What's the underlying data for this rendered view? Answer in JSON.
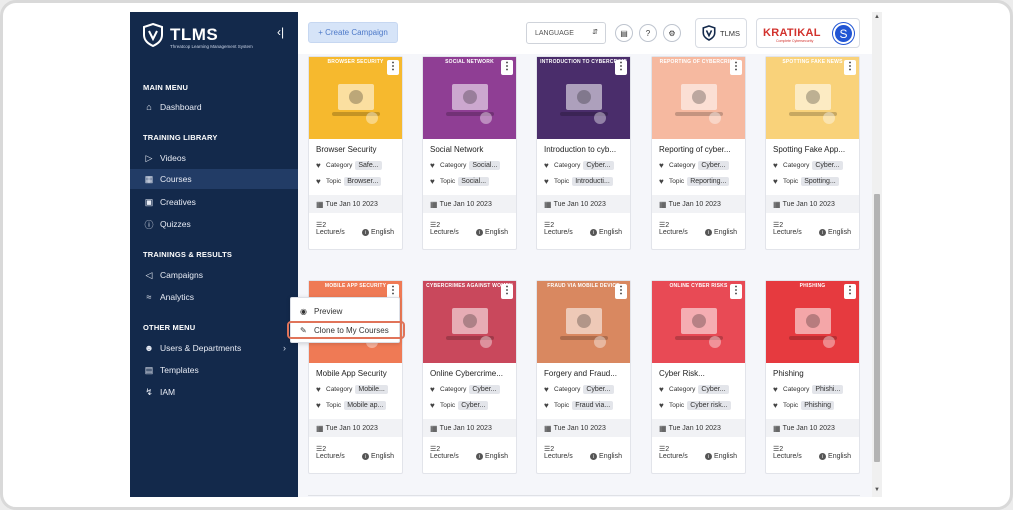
{
  "brand": {
    "name": "TLMS",
    "tagline": "Threatcop Learning Management System"
  },
  "sidebar": {
    "sections": [
      {
        "title": "MAIN MENU"
      },
      {
        "title": "TRAINING LIBRARY"
      },
      {
        "title": "TRAININGS & RESULTS"
      },
      {
        "title": "OTHER MENU"
      }
    ],
    "items": [
      {
        "label": "Dashboard",
        "icon": "home-icon"
      },
      {
        "label": "Videos",
        "icon": "video-icon"
      },
      {
        "label": "Courses",
        "icon": "book-icon",
        "active": true
      },
      {
        "label": "Creatives",
        "icon": "image-icon"
      },
      {
        "label": "Quizzes",
        "icon": "question-icon"
      },
      {
        "label": "Campaigns",
        "icon": "megaphone-icon"
      },
      {
        "label": "Analytics",
        "icon": "chart-icon"
      },
      {
        "label": "Users & Departments",
        "icon": "user-icon"
      },
      {
        "label": "Templates",
        "icon": "template-icon"
      },
      {
        "label": "IAM",
        "icon": "key-icon"
      }
    ]
  },
  "topbar": {
    "create_label": "+ Create Campaign",
    "language_label": "LANGUAGE",
    "tlms_label": "TLMS",
    "org_name": "KRATIKAL",
    "org_sub": "Complete Cybersecurity",
    "avatar_letter": "S"
  },
  "colors": {
    "sidebar_bg": "#13294b",
    "accent": "#4d79c8",
    "highlight": "#e0745a"
  },
  "courses": [
    {
      "thumb_title": "BROWSER SECURITY",
      "bg": "#f6b92e",
      "title": "Browser Security",
      "category": "Safe...",
      "topic": "Browser...",
      "date": "Tue Jan 10 2023",
      "lectures_num": "2",
      "lectures_unit": "Lecture/s",
      "lang": "English"
    },
    {
      "thumb_title": "SOCIAL NETWORK",
      "bg": "#8f3e94",
      "title": "Social Network",
      "category": "Social...",
      "topic": "Social...",
      "date": "Tue Jan 10 2023",
      "lectures_num": "2",
      "lectures_unit": "Lecture/s",
      "lang": "English"
    },
    {
      "thumb_title": "INTRODUCTION TO CYBERCRIME",
      "bg": "#4a2d6b",
      "title": "Introduction to cyb...",
      "category": "Cyber...",
      "topic": "Introducti...",
      "date": "Tue Jan 10 2023",
      "lectures_num": "2",
      "lectures_unit": "Lecture/s",
      "lang": "English"
    },
    {
      "thumb_title": "REPORTING OF CYBERCRIME",
      "bg": "#f6b9a0",
      "title": "Reporting of cyber...",
      "category": "Cyber...",
      "topic": "Reporting...",
      "date": "Tue Jan 10 2023",
      "lectures_num": "2",
      "lectures_unit": "Lecture/s",
      "lang": "English"
    },
    {
      "thumb_title": "SPOTTING FAKE NEWS",
      "bg": "#f9d27a",
      "title": "Spotting Fake App...",
      "category": "Cyber...",
      "topic": "Spotting...",
      "date": "Tue Jan 10 2023",
      "lectures_num": "2",
      "lectures_unit": "Lecture/s",
      "lang": "English"
    },
    {
      "thumb_title": "MOBILE APP SECURITY",
      "bg": "#ef7a55",
      "title": "Mobile App Security",
      "category": "Mobile...",
      "topic": "Mobile ap...",
      "date": "Tue Jan 10 2023",
      "lectures_num": "2",
      "lectures_unit": "Lecture/s",
      "lang": "English"
    },
    {
      "thumb_title": "CYBERCRIMES AGAINST WOMEN",
      "bg": "#c9485c",
      "title": "Online Cybercrime...",
      "category": "Cyber...",
      "topic": "Cyber...",
      "date": "Tue Jan 10 2023",
      "lectures_num": "2",
      "lectures_unit": "Lecture/s",
      "lang": "English"
    },
    {
      "thumb_title": "FRAUD VIA MOBILE DEVICE",
      "bg": "#d98860",
      "title": "Forgery and Fraud...",
      "category": "Cyber...",
      "topic": "Fraud via...",
      "date": "Tue Jan 10 2023",
      "lectures_num": "2",
      "lectures_unit": "Lecture/s",
      "lang": "English"
    },
    {
      "thumb_title": "ONLINE CYBER RISKS",
      "bg": "#e84a55",
      "title": "Cyber Risk...",
      "category": "Cyber...",
      "topic": "Cyber risk...",
      "date": "Tue Jan 10 2023",
      "lectures_num": "2",
      "lectures_unit": "Lecture/s",
      "lang": "English"
    },
    {
      "thumb_title": "PHISHING",
      "bg": "#e63a3f",
      "title": "Phishing",
      "category": "Phishi...",
      "topic": "Phishing",
      "date": "Tue Jan 10 2023",
      "lectures_num": "2",
      "lectures_unit": "Lecture/s",
      "lang": "English"
    }
  ],
  "labels": {
    "category": "Category",
    "topic": "Topic"
  },
  "context_menu": {
    "preview": "Preview",
    "clone": "Clone to My Courses"
  }
}
